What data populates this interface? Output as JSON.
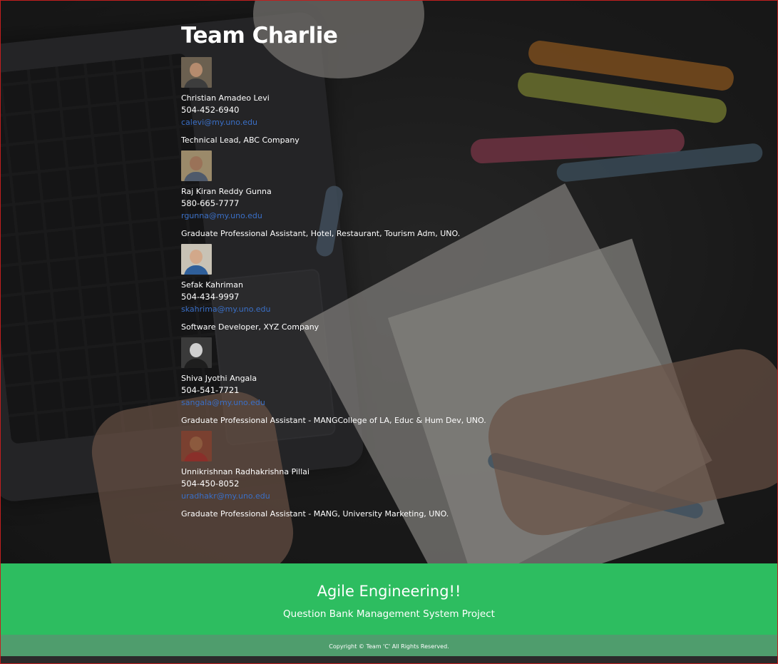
{
  "page": {
    "title": "Team Charlie"
  },
  "members": [
    {
      "name": "Christian Amadeo Levi",
      "phone": "504-452-6940",
      "email": "calevi@my.uno.edu",
      "role": "Technical Lead, ABC Company",
      "avatar_colors": {
        "bg": "#6b6050",
        "shirt": "#3d3d3d",
        "skin": "#b58b6e"
      }
    },
    {
      "name": "Raj Kiran Reddy Gunna",
      "phone": "580-665-7777",
      "email": "rgunna@my.uno.edu",
      "role": "Graduate Professional Assistant, Hotel, Restaurant, Tourism Adm, UNO.",
      "avatar_colors": {
        "bg": "#9b8a6a",
        "shirt": "#4f5a6b",
        "skin": "#9a7258"
      }
    },
    {
      "name": "Sefak Kahriman",
      "phone": "504-434-9997",
      "email": "skahrima@my.uno.edu",
      "role": "Software Developer, XYZ Company",
      "avatar_colors": {
        "bg": "#c8c2b5",
        "shirt": "#2f5f9a",
        "skin": "#d2a88a"
      }
    },
    {
      "name": "Shiva Jyothi Angala",
      "phone": "504-541-7721",
      "email": "sangala@my.uno.edu",
      "role": "Graduate Professional Assistant - MANGCollege of LA, Educ & Hum Dev, UNO.",
      "avatar_colors": {
        "bg": "#3a3a3a",
        "shirt": "#1e1e1e",
        "skin": "#cfcfcf"
      }
    },
    {
      "name": "Unnikrishnan Radhakrishna Pillai",
      "phone": "504-450-8052",
      "email": "uradhakr@my.uno.edu",
      "role": "Graduate Professional Assistant - MANG, University Marketing, UNO.",
      "avatar_colors": {
        "bg": "#7a4030",
        "shirt": "#8a2f2a",
        "skin": "#8c5a3e"
      }
    }
  ],
  "footer": {
    "title": "Agile Engineering!!",
    "subtitle": "Question Bank Management System Project",
    "copyright": "Copyright © Team 'C' All Rights Reserved.",
    "color": "#2dbd60",
    "copyright_bar_color": "#4f9d6d"
  }
}
